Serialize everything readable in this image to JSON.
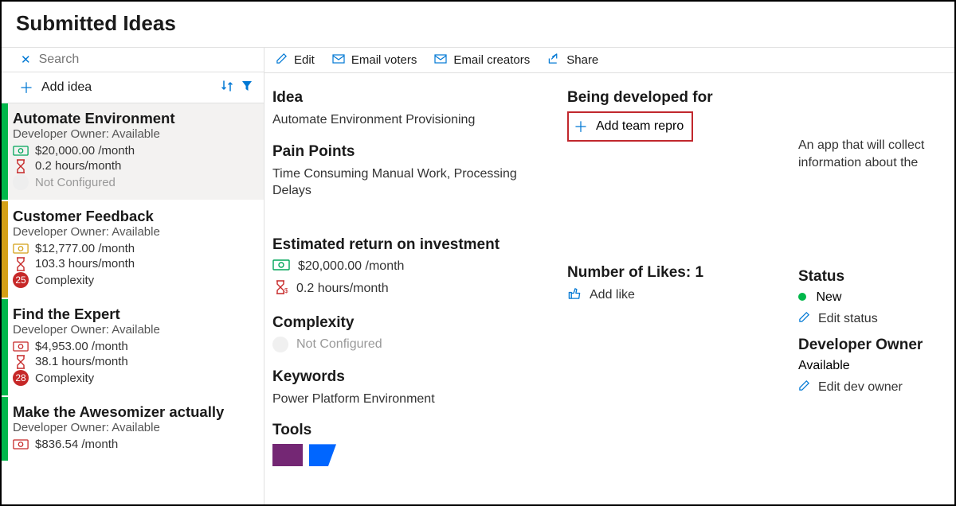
{
  "page_title": "Submitted Ideas",
  "search": {
    "placeholder": "Search"
  },
  "add_idea_label": "Add idea",
  "toolbar": {
    "edit": "Edit",
    "email_voters": "Email voters",
    "email_creators": "Email creators",
    "share": "Share"
  },
  "ideas": [
    {
      "title": "Automate Environment",
      "owner": "Developer Owner: Available",
      "cost": "$20,000.00 /month",
      "hours": "0.2 hours/month",
      "complexity_label": "Not Configured",
      "complexity_badge": null,
      "stripe": "green",
      "money_color": "green",
      "selected": true
    },
    {
      "title": "Customer Feedback",
      "owner": "Developer Owner: Available",
      "cost": "$12,777.00 /month",
      "hours": "103.3 hours/month",
      "complexity_label": "Complexity",
      "complexity_badge": "25",
      "stripe": "yellow",
      "money_color": "yellow",
      "selected": false
    },
    {
      "title": "Find the Expert",
      "owner": "Developer Owner: Available",
      "cost": "$4,953.00 /month",
      "hours": "38.1 hours/month",
      "complexity_label": "Complexity",
      "complexity_badge": "28",
      "stripe": "green",
      "money_color": "red",
      "selected": false
    },
    {
      "title": "Make the Awesomizer actually",
      "owner": "Developer Owner: Available",
      "cost": "$836.54 /month",
      "hours": "",
      "complexity_label": "",
      "complexity_badge": null,
      "stripe": "green",
      "money_color": "red",
      "selected": false
    }
  ],
  "detail": {
    "idea_h": "Idea",
    "idea_v": "Automate Environment Provisioning",
    "pain_h": "Pain Points",
    "pain_v": "Time Consuming Manual Work, Processing Delays",
    "roi_h": "Estimated return on investment",
    "roi_cost": "$20,000.00 /month",
    "roi_hours": "0.2 hours/month",
    "complexity_h": "Complexity",
    "complexity_v": "Not Configured",
    "keywords_h": "Keywords",
    "keywords_v": "Power Platform Environment",
    "tools_h": "Tools",
    "devfor_h": "Being developed for",
    "add_team": "Add team repro",
    "likes_h": "Number of Likes: 1",
    "add_like": "Add like",
    "description": "An app that will collect information about the",
    "status_h": "Status",
    "status_v": "New",
    "edit_status": "Edit status",
    "devowner_h": "Developer Owner",
    "devowner_v": "Available",
    "edit_devowner": "Edit dev owner"
  }
}
